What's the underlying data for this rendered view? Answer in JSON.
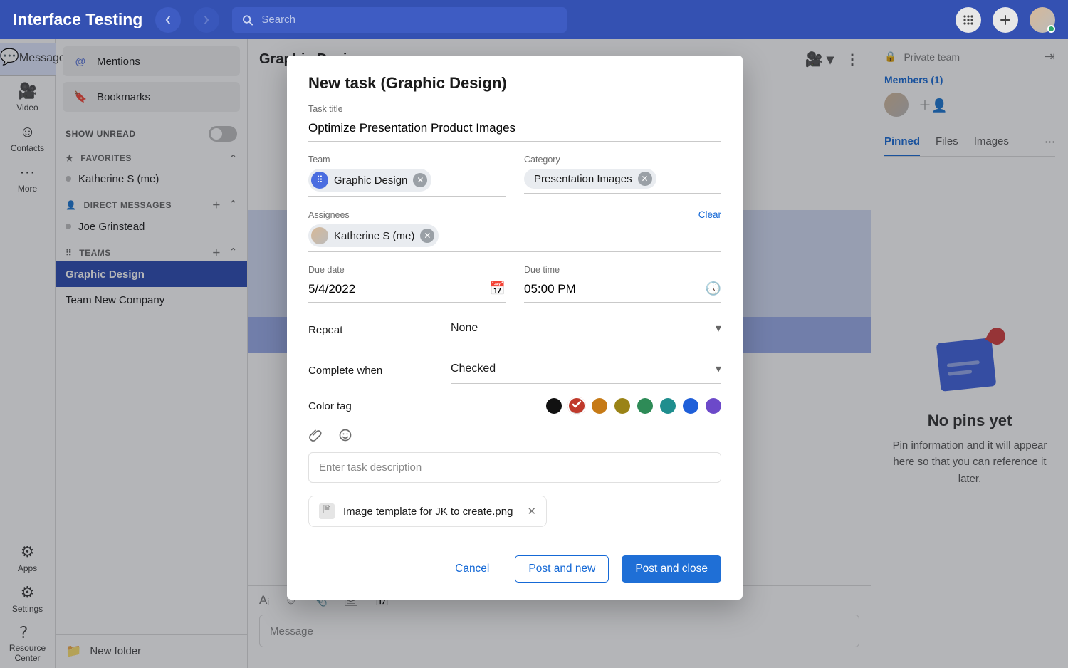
{
  "brand": "Interface Testing",
  "search_placeholder": "Search",
  "rail": {
    "message": "Message",
    "video": "Video",
    "contacts": "Contacts",
    "more": "More",
    "apps": "Apps",
    "settings": "Settings",
    "resource": "Resource Center"
  },
  "sidebar": {
    "mentions": "Mentions",
    "bookmarks": "Bookmarks",
    "show_unread": "SHOW UNREAD",
    "favorites": "FAVORITES",
    "fav": [
      "Katherine S (me)"
    ],
    "dm_label": "DIRECT MESSAGES",
    "dms": [
      "Joe Grinstead"
    ],
    "teams_label": "TEAMS",
    "teams": [
      "Graphic Design",
      "Team New Company"
    ],
    "new_folder": "New folder"
  },
  "channel": {
    "title": "Graphic Design",
    "composer_placeholder": "Message"
  },
  "right": {
    "private": "Private team",
    "members": "Members (1)",
    "tabs": [
      "Pinned",
      "Files",
      "Images"
    ],
    "empty_title": "No pins yet",
    "empty_body": "Pin information and it will appear here so that you can reference it later."
  },
  "modal": {
    "title": "New task (Graphic Design)",
    "labels": {
      "task_title": "Task title",
      "team": "Team",
      "category": "Category",
      "assignees": "Assignees",
      "clear": "Clear",
      "due_date": "Due date",
      "due_time": "Due time",
      "repeat": "Repeat",
      "complete_when": "Complete when",
      "color_tag": "Color tag",
      "description_placeholder": "Enter task description"
    },
    "values": {
      "task_title": "Optimize Presentation Product Images",
      "team": "Graphic Design",
      "category": "Presentation Images",
      "assignee": "Katherine S (me)",
      "due_date": "5/4/2022",
      "due_time": "05:00 PM",
      "repeat": "None",
      "complete_when": "Checked"
    },
    "colors": [
      "#111111",
      "#c0392b",
      "#c67a16",
      "#9a8316",
      "#2e8b57",
      "#1f8e8e",
      "#1f5fd9",
      "#6c49c9"
    ],
    "selected_color_index": 1,
    "attachment": "Image template for JK to create.png",
    "buttons": {
      "cancel": "Cancel",
      "post_new": "Post and new",
      "post_close": "Post and close"
    }
  }
}
